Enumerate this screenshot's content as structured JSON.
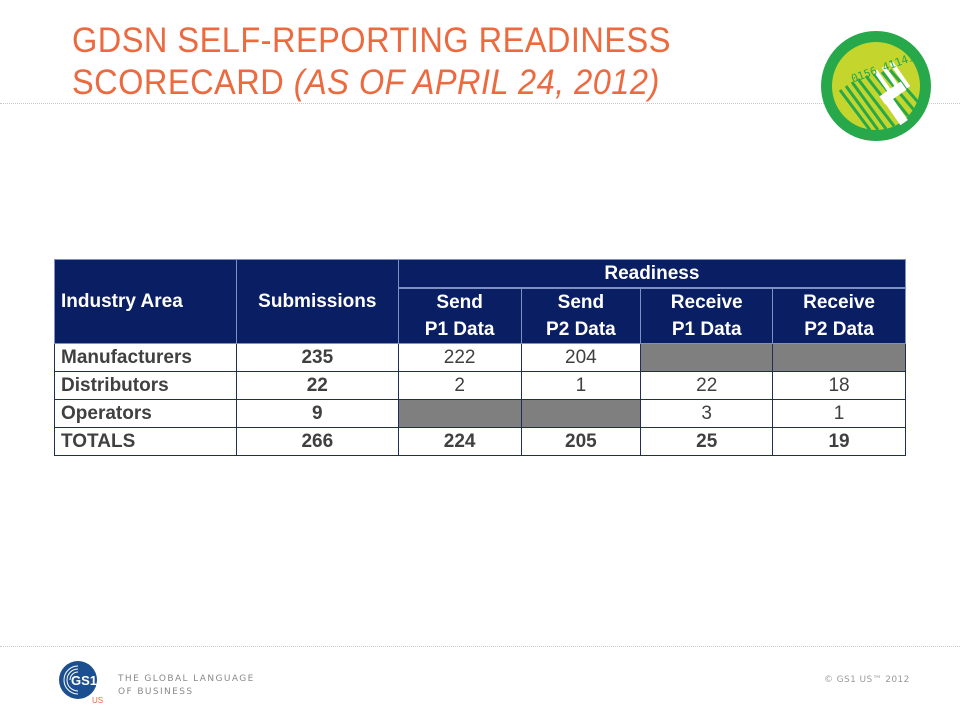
{
  "slide": {
    "title_line1": "GDSN SELF-REPORTING READINESS",
    "title_line2_main": "SCORECARD ",
    "title_line2_sub": "(AS OF APRIL 24, 2012)",
    "accent_color": "#ec6a3f",
    "badge_icon": "barcode-fork-icon",
    "badge_digits": "0156 41141"
  },
  "table": {
    "header_color": "#0a1f63",
    "na_color": "#7f7f7f",
    "headers": {
      "industry_area": "Industry Area",
      "submissions": "Submissions",
      "readiness": "Readiness",
      "columns": [
        {
          "line1": "Send",
          "line2": "P1 Data"
        },
        {
          "line1": "Send",
          "line2": "P2 Data"
        },
        {
          "line1": "Receive",
          "line2": "P1 Data"
        },
        {
          "line1": "Receive",
          "line2": "P2 Data"
        }
      ]
    },
    "rows": [
      {
        "area": "Manufacturers",
        "submissions": "235",
        "send_p1": "222",
        "send_p2": "204",
        "receive_p1": null,
        "receive_p2": null
      },
      {
        "area": "Distributors",
        "submissions": "22",
        "send_p1": "2",
        "send_p2": "1",
        "receive_p1": "22",
        "receive_p2": "18"
      },
      {
        "area": "Operators",
        "submissions": "9",
        "send_p1": null,
        "send_p2": null,
        "receive_p1": "3",
        "receive_p2": "1"
      }
    ],
    "totals": {
      "area": "TOTALS",
      "submissions": "266",
      "send_p1": "224",
      "send_p2": "205",
      "receive_p1": "25",
      "receive_p2": "19"
    }
  },
  "footer": {
    "logo_text": "GS1",
    "logo_sub": "US",
    "tagline_line1": "THE GLOBAL LANGUAGE",
    "tagline_line2": "OF BUSINESS",
    "copyright": "© GS1 US™ 2012"
  }
}
